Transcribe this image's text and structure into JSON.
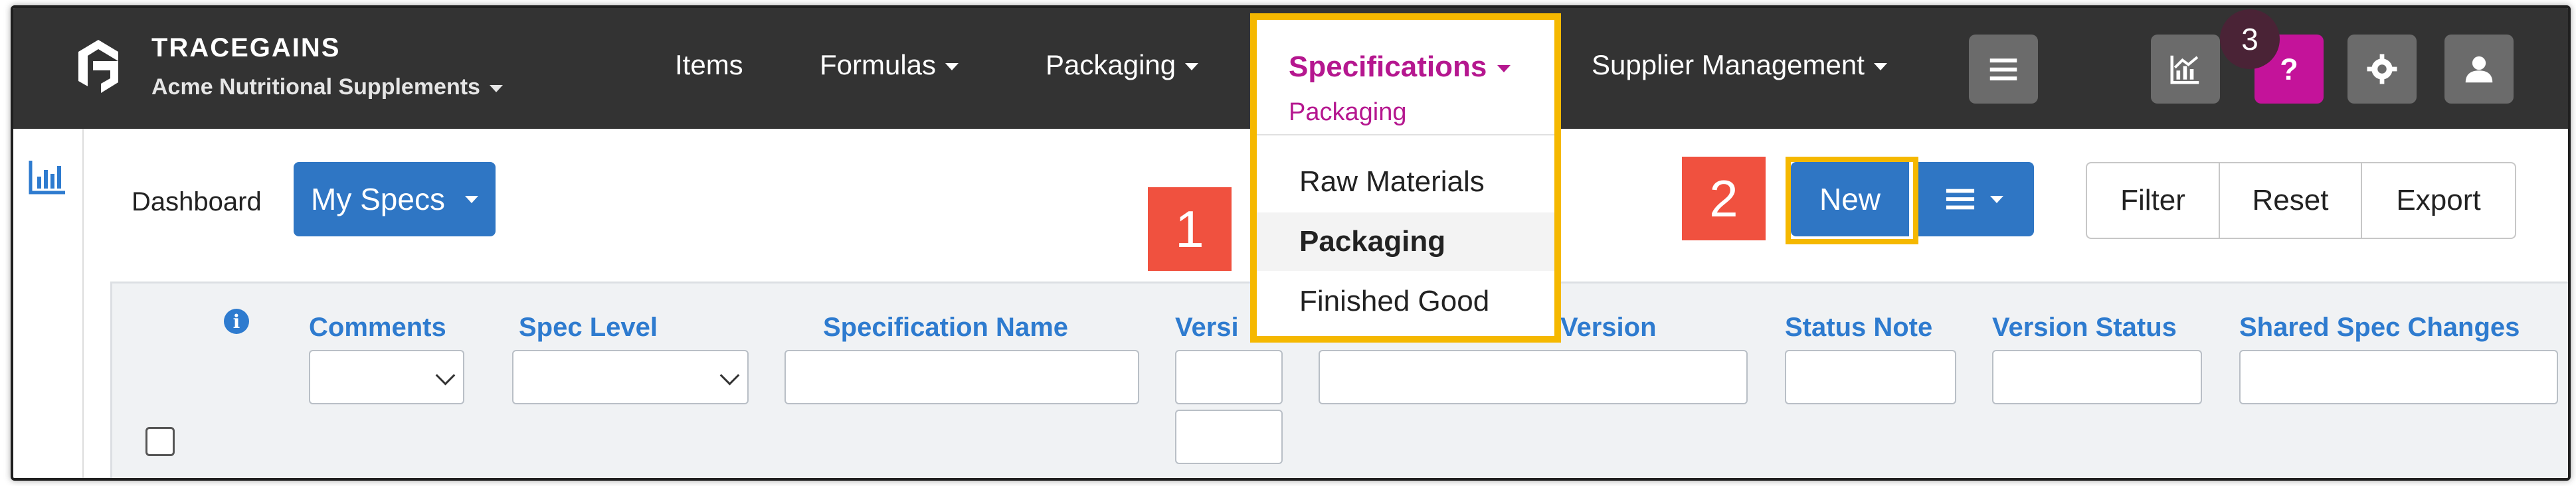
{
  "brand": {
    "name": "TRACEGAINS",
    "org": "Acme Nutritional Supplements"
  },
  "nav": {
    "items": [
      "Items",
      "Formulas",
      "Packaging"
    ],
    "supplier": "Supplier Management",
    "specifications": {
      "label": "Specifications",
      "selected": "Packaging"
    }
  },
  "icons": {
    "menu": "hamburger-icon",
    "analytics": "chart-icon",
    "help": "question-icon",
    "settings": "gear-icon",
    "user": "user-icon"
  },
  "badges": {
    "help_count": "3"
  },
  "toolbar": {
    "dashboard": "Dashboard",
    "my_specs": "My Specs",
    "new": "New",
    "filter": "Filter",
    "reset": "Reset",
    "export": "Export"
  },
  "callouts": {
    "one": "1",
    "two": "2"
  },
  "dropdown": {
    "items": [
      "Raw Materials",
      "Packaging",
      "Finished Good"
    ],
    "active": "Packaging"
  },
  "table": {
    "columns": [
      "Comments",
      "Spec Level",
      "Specification Name",
      "Versi",
      "Version",
      "Status Note",
      "Version Status",
      "Shared Spec Changes"
    ]
  },
  "colors": {
    "navbar": "#333333",
    "accent_blue": "#2f76c4",
    "magenta": "#b5178f",
    "highlight": "#f5b800",
    "callout": "#f0513f"
  }
}
